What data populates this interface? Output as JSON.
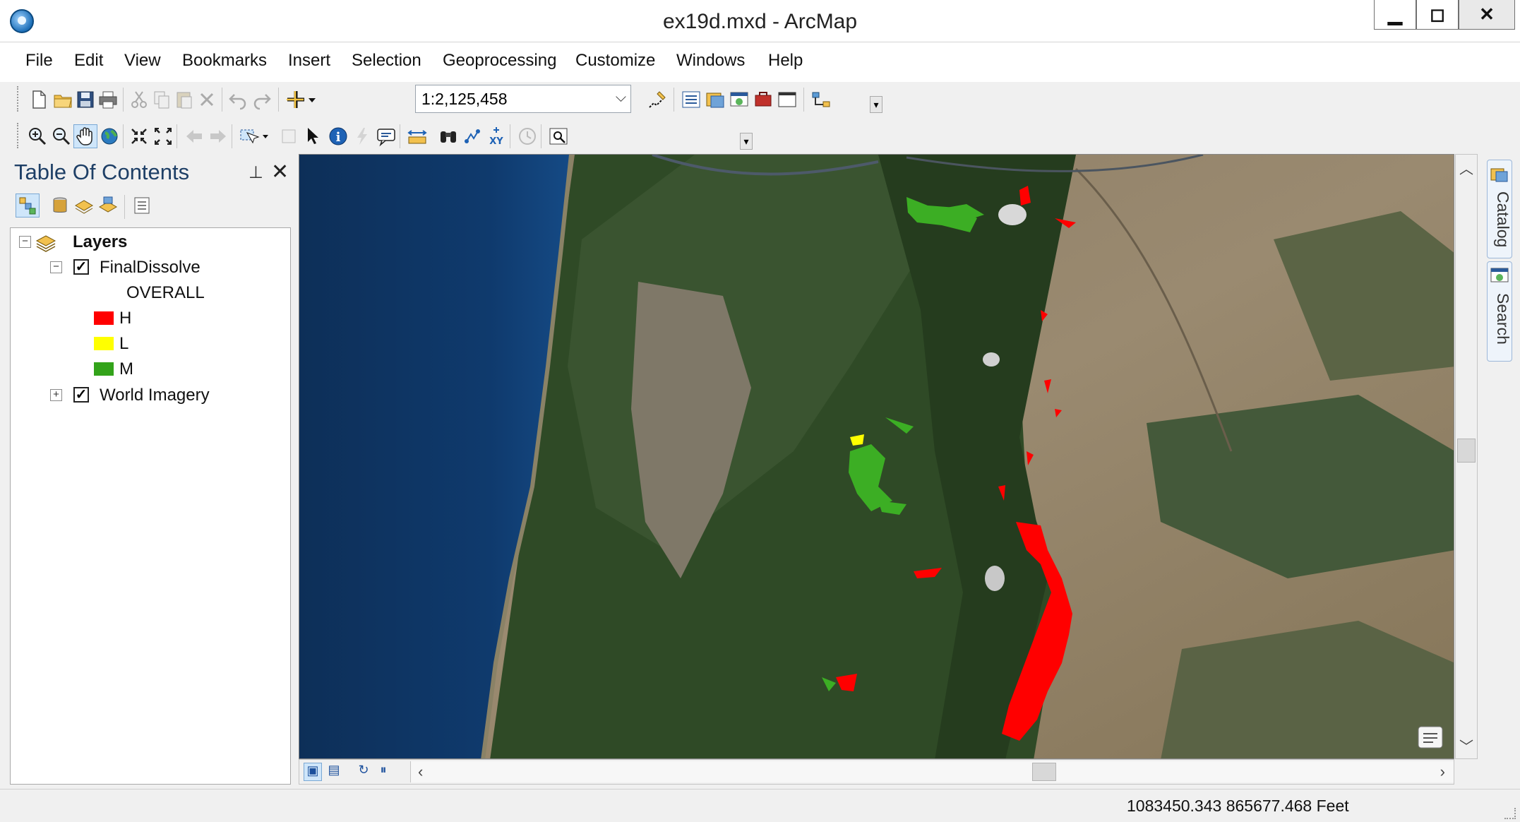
{
  "window": {
    "title": "ex19d.mxd - ArcMap",
    "minimize": "▁",
    "maximize": "◻",
    "close": "✕"
  },
  "menu": [
    "File",
    "Edit",
    "View",
    "Bookmarks",
    "Insert",
    "Selection",
    "Geoprocessing",
    "Customize",
    "Windows",
    "Help"
  ],
  "toolbar": {
    "scale": "1:2,125,458"
  },
  "toc": {
    "title": "Table Of Contents",
    "root": "Layers",
    "layer1": {
      "name": "FinalDissolve",
      "checked": true,
      "field": "OVERALL"
    },
    "legend": [
      {
        "label": "H",
        "color": "#ff0000"
      },
      {
        "label": "L",
        "color": "#ffff00"
      },
      {
        "label": "M",
        "color": "#33a31a"
      }
    ],
    "layer2": {
      "name": "World Imagery",
      "checked": true
    }
  },
  "dock": {
    "catalog": "Catalog",
    "search": "Search"
  },
  "status": {
    "coordinates": "1083450.343  865677.468 Feet"
  }
}
